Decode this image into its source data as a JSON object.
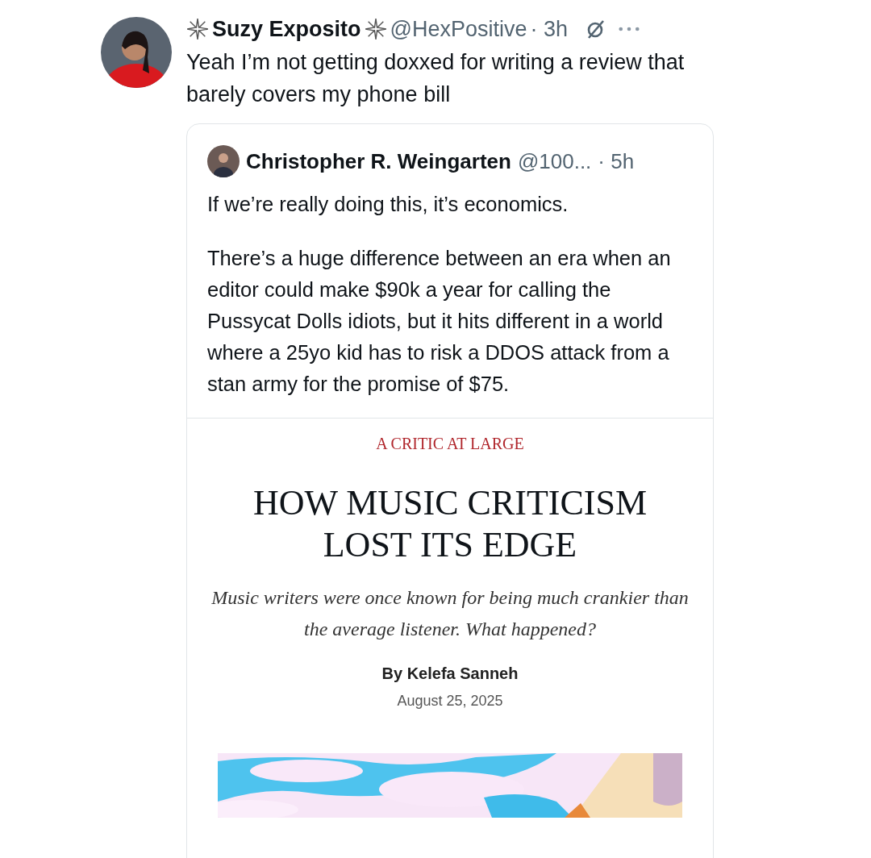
{
  "tweet": {
    "author": {
      "name": "Suzy Exposito",
      "handle": "@HexPositive",
      "time": "· 3h"
    },
    "text": "Yeah I’m not getting doxxed for writing a review that barely covers my phone bill",
    "quoted_tweet": {
      "author": {
        "name": "Christopher R. Weingarten",
        "handle": "@100...",
        "time": "· 5h"
      },
      "paragraphs": [
        "If we’re really doing this, it’s economics.",
        "There’s a huge difference between an era when an editor could make $90k a year for calling the Pussycat Dolls idiots, but it hits different in a world where a 25yo kid has to risk a DDOS attack from a stan army for the promise of $75."
      ],
      "article": {
        "kicker": "A CRITIC AT LARGE",
        "headline": "HOW MUSIC CRITICISM LOST ITS EDGE",
        "deck": "Music writers were once known for being much crankier than the average listener. What happened?",
        "byline": "By Kelefa Sanneh",
        "date": "August 25, 2025"
      }
    }
  }
}
